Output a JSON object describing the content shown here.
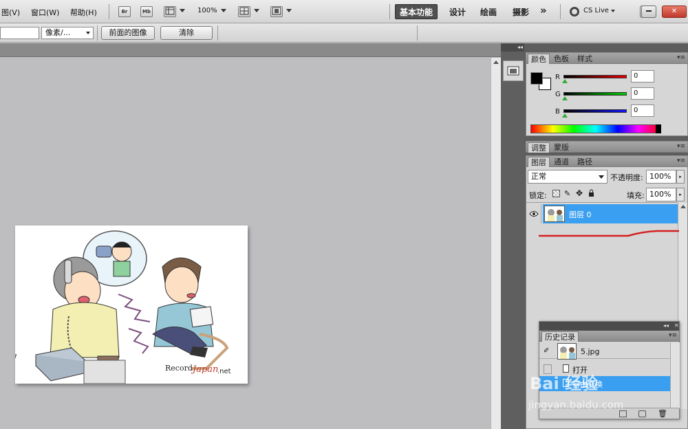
{
  "menu": {
    "items": [
      "图(V)",
      "窗口(W)",
      "帮助(H)"
    ],
    "bridge": "Br",
    "minibridge": "Mb",
    "zoom": "100%",
    "workspaces": {
      "active": "基本功能",
      "design": "设计",
      "paint": "绘画",
      "photo": "摄影",
      "more": "»"
    },
    "cs_live": "CS Live",
    "window_buttons": {
      "minimize": "▭",
      "restore": "⧉",
      "close": "✕"
    }
  },
  "options": {
    "unit": "像素/...",
    "front_image_button": "前面的图像",
    "clear_button": "清除"
  },
  "color_panel": {
    "tabs": [
      "颜色",
      "色板",
      "样式"
    ],
    "channels": [
      {
        "label": "R",
        "value": "0",
        "color": "#d01010"
      },
      {
        "label": "G",
        "value": "0",
        "color": "#10b010"
      },
      {
        "label": "B",
        "value": "0",
        "color": "#1020d0"
      }
    ]
  },
  "adjust_panel": {
    "tabs": [
      "调整",
      "蒙版"
    ]
  },
  "layers_panel": {
    "tabs": [
      "图层",
      "通道",
      "路径"
    ],
    "blend_mode": "正常",
    "opacity_label": "不透明度:",
    "opacity": "100%",
    "lock_label": "锁定:",
    "fill_label": "填充:",
    "fill": "100%",
    "layer_name": "图层 0"
  },
  "history_panel": {
    "title": "历史记录",
    "snapshot": "5.jpg",
    "steps": [
      "打开",
      "自由变换"
    ]
  },
  "watermark": {
    "logo": "Bai 经验",
    "url": "jingyan.baidu.com"
  },
  "canvas_text": {
    "credit": "Record",
    "brand": "Japan",
    "suffix": ".net"
  }
}
